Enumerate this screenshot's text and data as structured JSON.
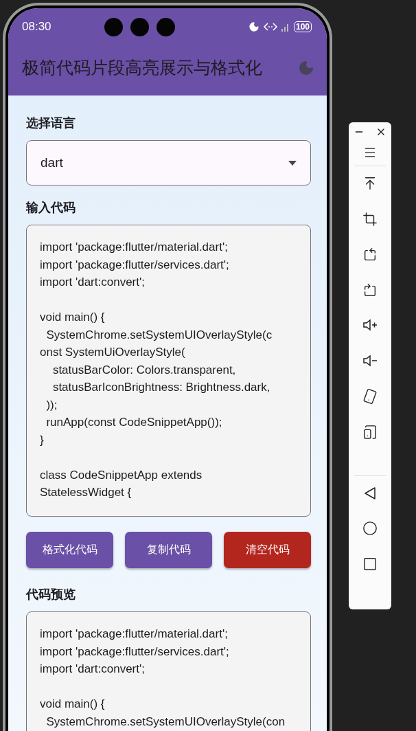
{
  "status_bar": {
    "time": "08:30",
    "battery": "100"
  },
  "app_bar": {
    "title": "极简代码片段高亮展示与格式化"
  },
  "language": {
    "label": "选择语言",
    "value": "dart"
  },
  "input": {
    "label": "输入代码",
    "blocks": [
      [
        "import 'package:flutter/material.dart';",
        "import 'package:flutter/services.dart';",
        "import 'dart:convert';"
      ],
      [
        "void main() {",
        "  SystemChrome.setSystemUIOverlayStyle(c",
        "onst SystemUiOverlayStyle(",
        "    statusBarColor: Colors.transparent,",
        "    statusBarIconBrightness: Brightness.dark,",
        "  ));",
        "  runApp(const CodeSnippetApp());",
        "}"
      ],
      [
        "class CodeSnippetApp extends",
        "StatelessWidget {"
      ]
    ]
  },
  "buttons": [
    {
      "label": "格式化代码",
      "kind": "primary"
    },
    {
      "label": "复制代码",
      "kind": "primary"
    },
    {
      "label": "清空代码",
      "kind": "danger"
    }
  ],
  "preview": {
    "label": "代码预览",
    "blocks": [
      [
        "import 'package:flutter/material.dart';",
        "import 'package:flutter/services.dart';",
        "import 'dart:convert';"
      ],
      [
        "void main() {",
        "  SystemChrome.setSystemUIOverlayStyle(con"
      ]
    ]
  }
}
